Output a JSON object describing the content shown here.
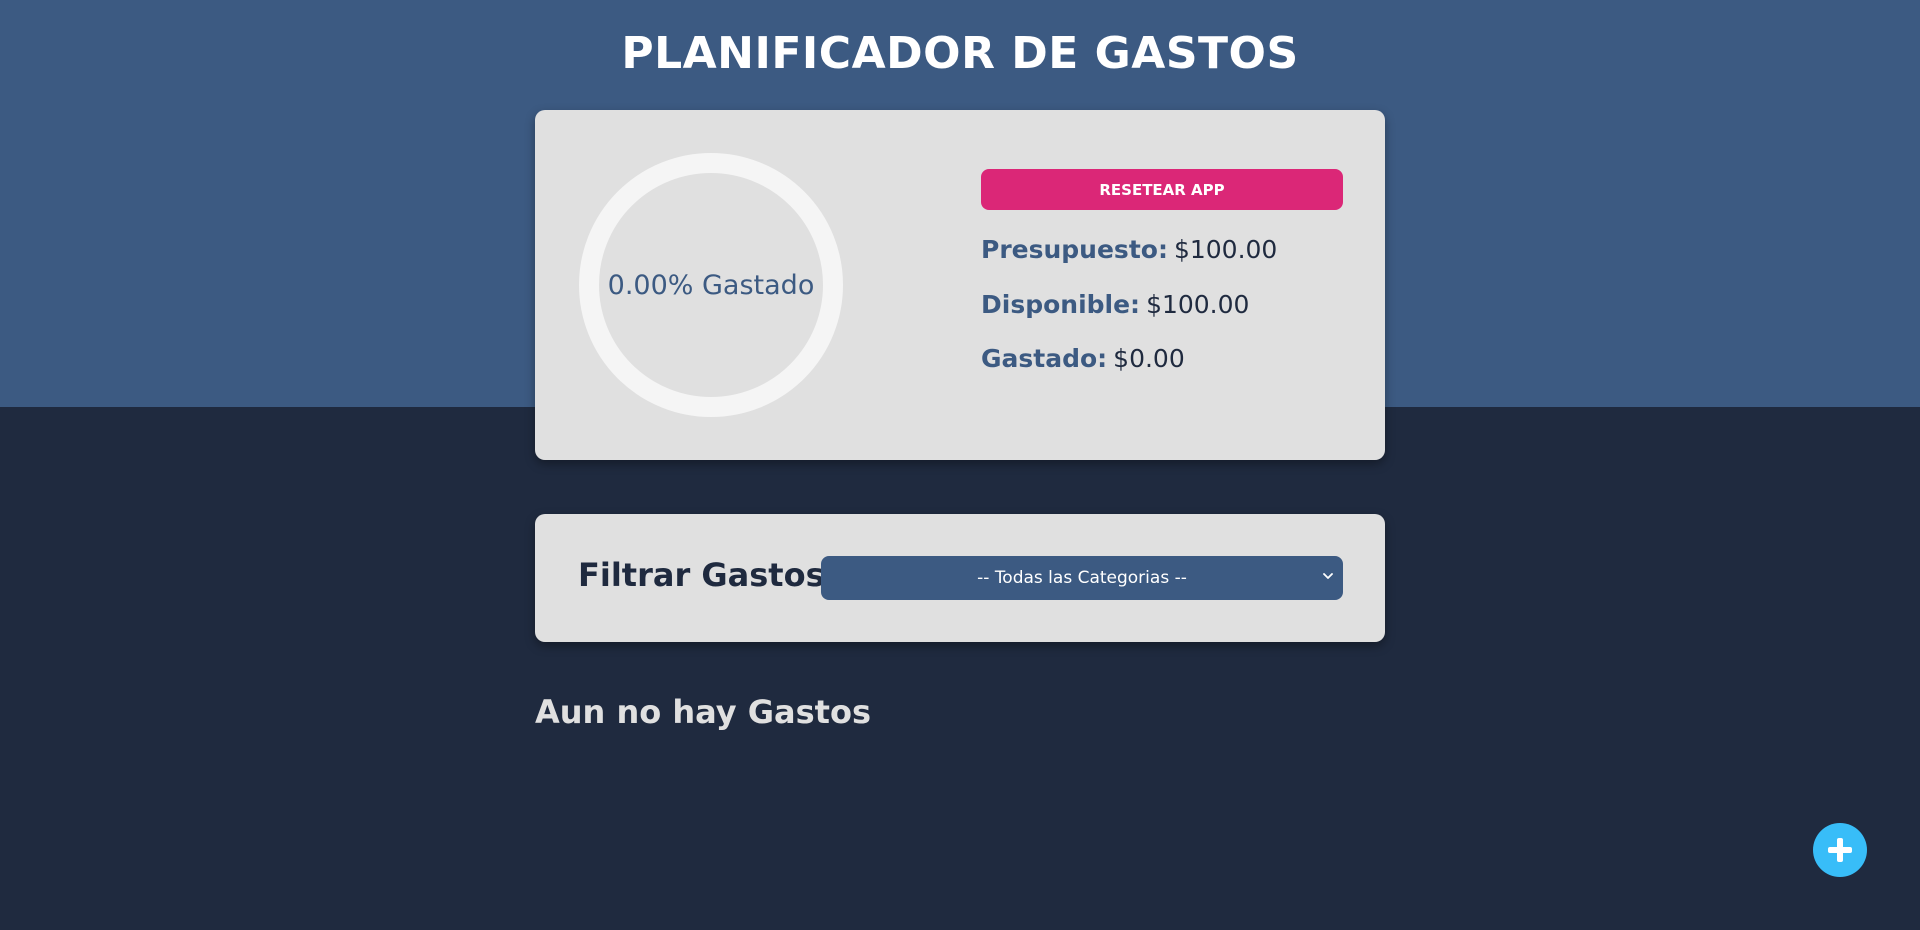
{
  "header": {
    "title": "PLANIFICADOR DE GASTOS"
  },
  "budget": {
    "progress_label": "0.00% Gastado",
    "progress_percent": 0,
    "reset_label": "RESETEAR APP",
    "budget_label": "Presupuesto:",
    "budget_value": "$100.00",
    "available_label": "Disponible:",
    "available_value": "$100.00",
    "spent_label": "Gastado:",
    "spent_value": "$0.00"
  },
  "filter": {
    "label": "Filtrar Gastos",
    "selected_option": "-- Todas las Categorias --"
  },
  "expenses": {
    "empty_message": "Aun no hay Gastos"
  },
  "icons": {
    "add": "plus-icon",
    "dropdown": "chevron-down-icon"
  },
  "colors": {
    "top_band": "#3c5a82",
    "background": "#1f2a3f",
    "card": "#e0e0e0",
    "accent_reset": "#db2777",
    "accent_add": "#38bdf8",
    "progress_track": "#f5f5f5"
  }
}
